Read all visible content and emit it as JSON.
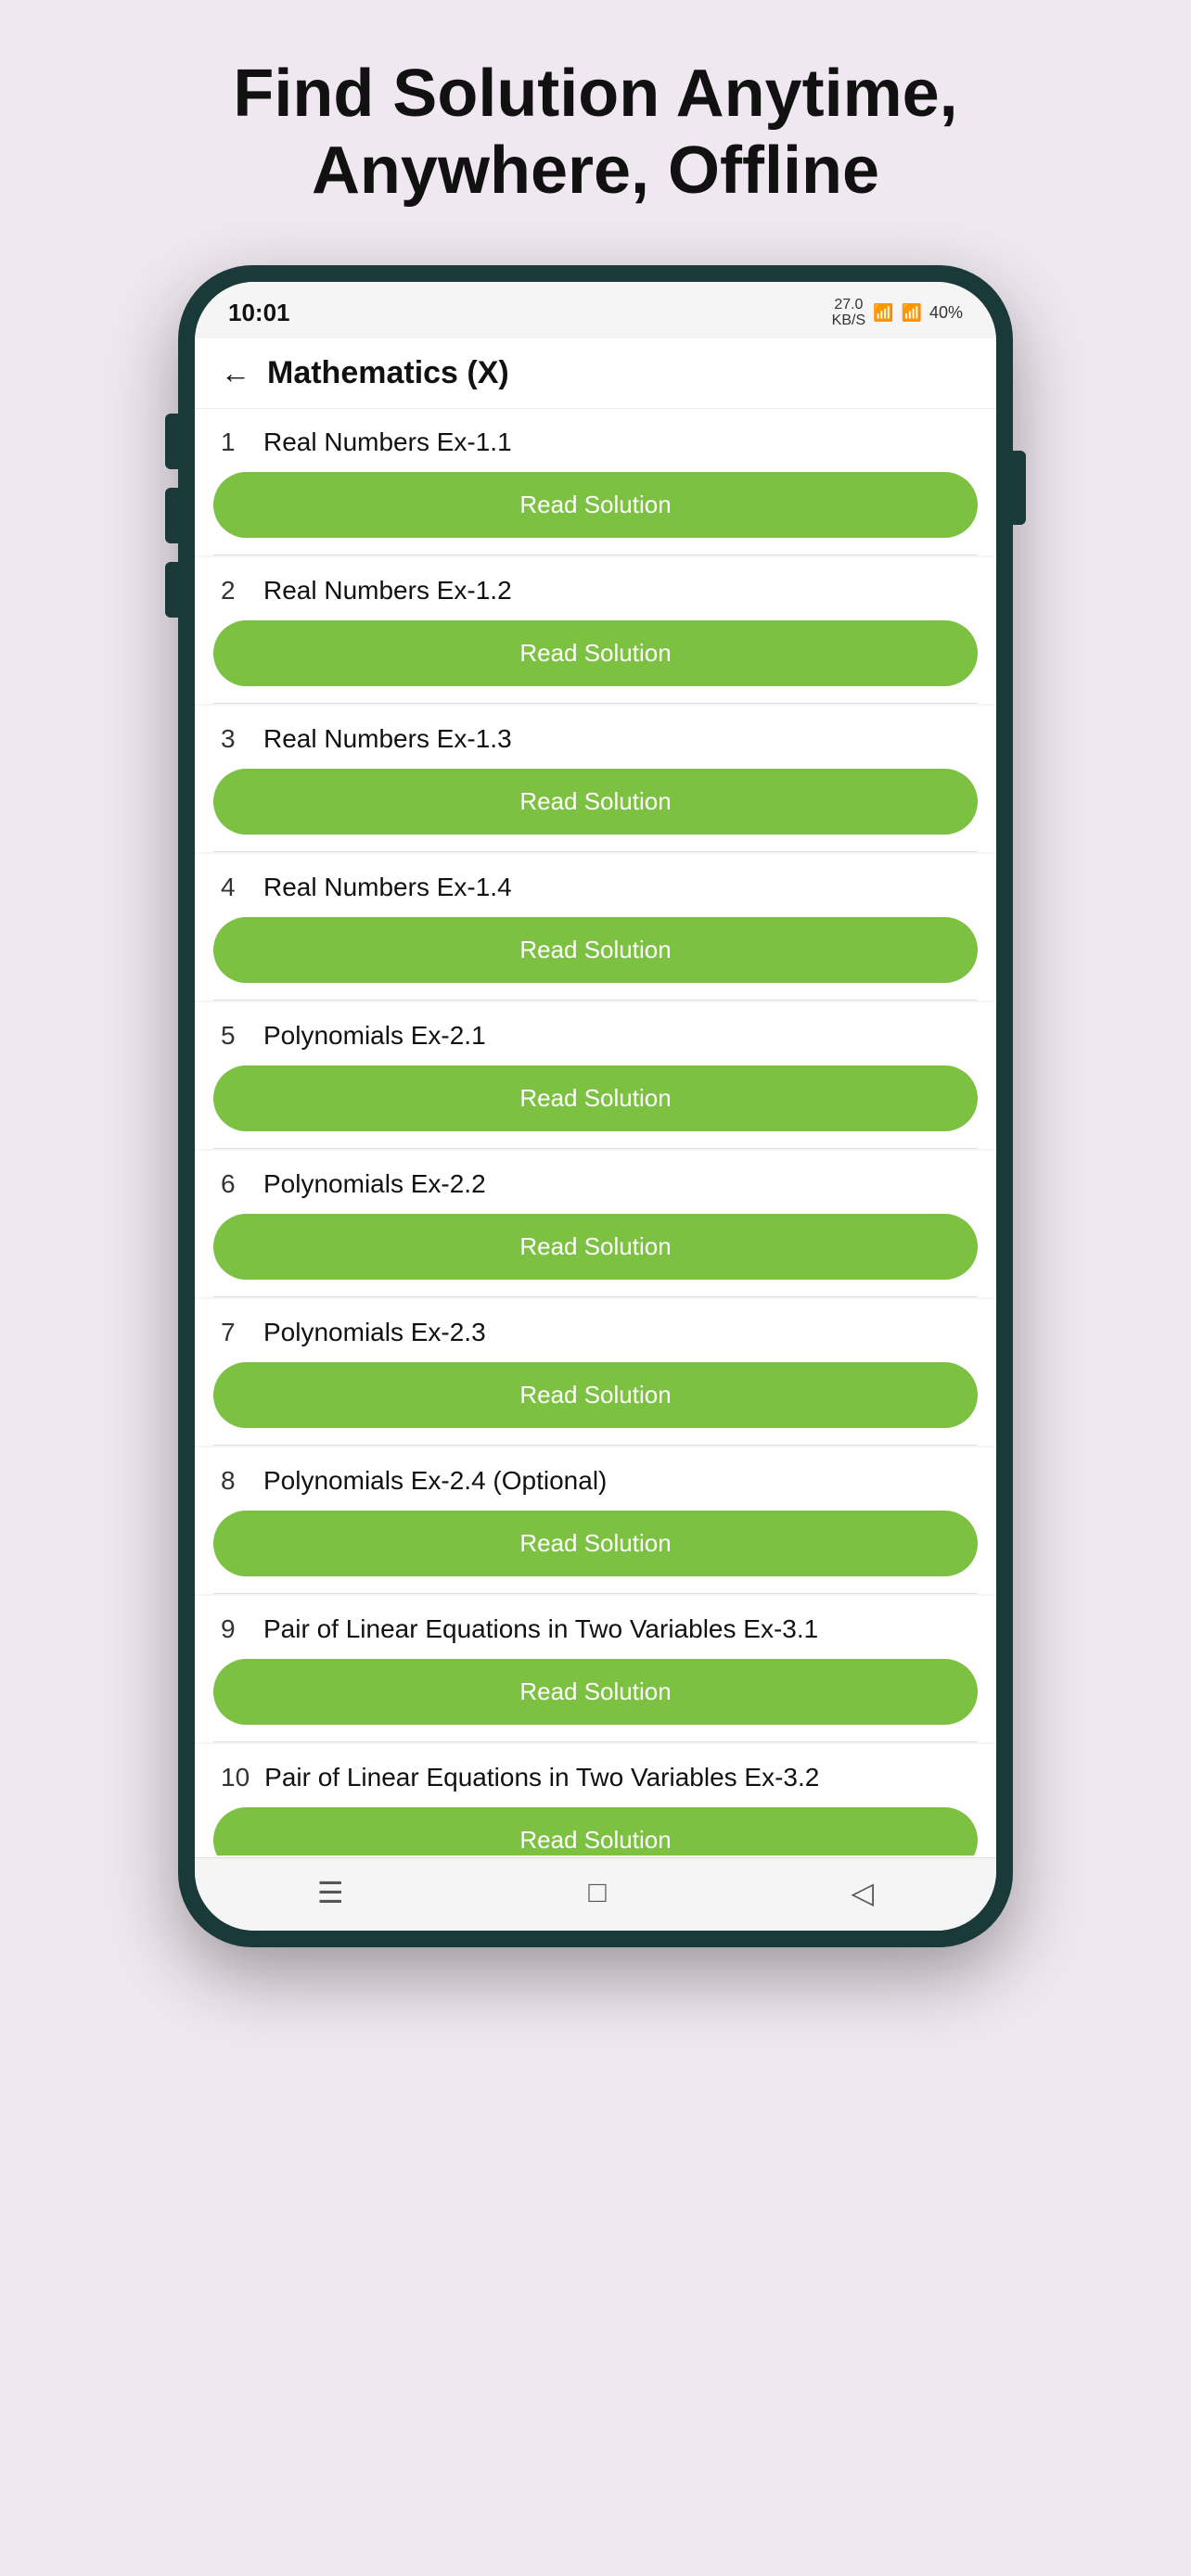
{
  "page": {
    "title": "Find Solution Anytime,\nAnywhere, Offline",
    "background_color": "#f0e8f0"
  },
  "phone": {
    "status_bar": {
      "time": "10:01",
      "data_speed": "27.0\nKB/S",
      "battery": "40%"
    },
    "header": {
      "title": "Mathematics (X)",
      "back_label": "←"
    },
    "items": [
      {
        "number": "1",
        "title": "Real Numbers Ex-1.1",
        "button": "Read Solution"
      },
      {
        "number": "2",
        "title": "Real Numbers Ex-1.2",
        "button": "Read Solution"
      },
      {
        "number": "3",
        "title": "Real Numbers Ex-1.3",
        "button": "Read Solution"
      },
      {
        "number": "4",
        "title": "Real Numbers Ex-1.4",
        "button": "Read Solution"
      },
      {
        "number": "5",
        "title": "Polynomials Ex-2.1",
        "button": "Read Solution"
      },
      {
        "number": "6",
        "title": "Polynomials Ex-2.2",
        "button": "Read Solution"
      },
      {
        "number": "7",
        "title": "Polynomials Ex-2.3",
        "button": "Read Solution"
      },
      {
        "number": "8",
        "title": "Polynomials Ex-2.4 (Optional)",
        "button": "Read Solution"
      },
      {
        "number": "9",
        "title": "Pair of Linear Equations in Two Variables Ex-3.1",
        "button": "Read Solution"
      },
      {
        "number": "10",
        "title": "Pair of Linear Equations in Two Variables Ex-3.2",
        "button": "Read Solution"
      }
    ],
    "nav": {
      "menu_icon": "☰",
      "home_icon": "□",
      "back_icon": "◁"
    }
  }
}
